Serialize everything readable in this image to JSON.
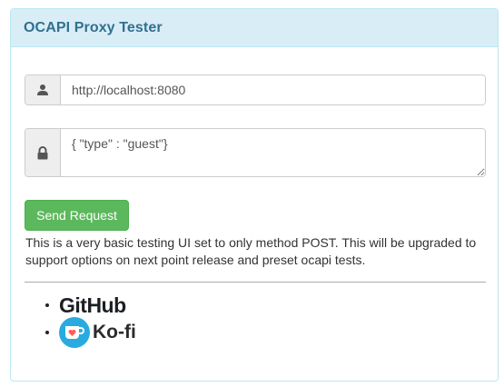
{
  "panel": {
    "title": "OCAPI Proxy Tester"
  },
  "form": {
    "url": {
      "value": "http://localhost:8080",
      "icon": "user-icon"
    },
    "body": {
      "value": "{ \"type\" : \"guest\"}",
      "icon": "lock-icon"
    },
    "send_label": "Send Request"
  },
  "description": "This is a very basic testing UI set to only method POST. This will be upgraded to support options on next point release and preset ocapi tests.",
  "links": {
    "github_label": "GitHub",
    "kofi_label": "Ko-fi"
  },
  "colors": {
    "heading_bg": "#d9edf7",
    "heading_text": "#31708f",
    "border": "#bce8f1",
    "success": "#5cb85c",
    "kofi": "#29abe0"
  }
}
